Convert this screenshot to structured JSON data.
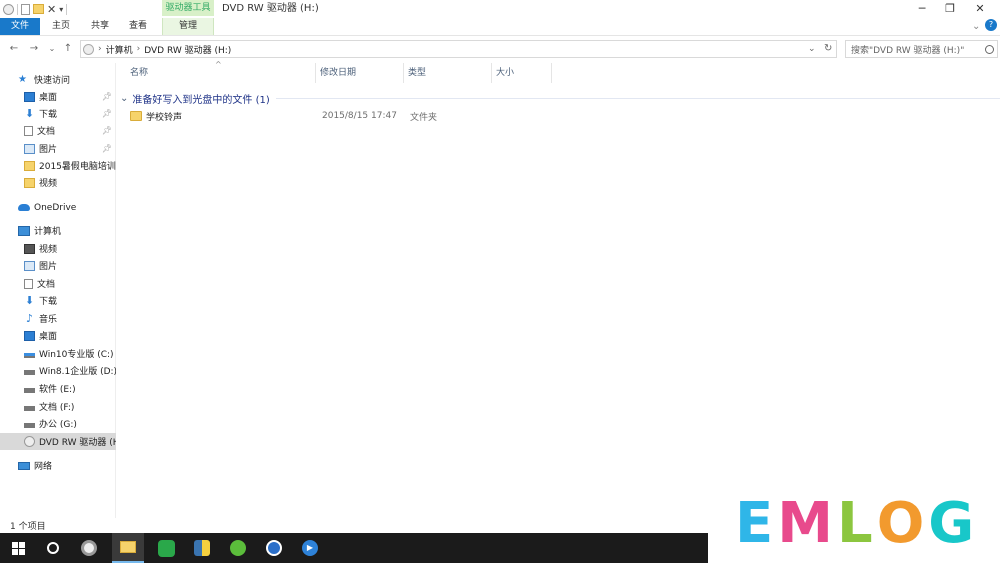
{
  "window": {
    "title": "DVD RW 驱动器 (H:)",
    "context_tab_header": "驱动器工具",
    "controls": {
      "minimize": "─",
      "restore": "❐",
      "close": "✕",
      "help": "?",
      "expand": "⌄"
    }
  },
  "ribbon": {
    "tabs": [
      "文件",
      "主页",
      "共享",
      "查看",
      "管理"
    ]
  },
  "address": {
    "back": "←",
    "forward": "→",
    "history": "⌄",
    "up": "↑",
    "crumbs": [
      "计算机",
      "DVD RW 驱动器 (H:)"
    ],
    "separator": "›",
    "dropdown": "⌄",
    "refresh": "↻"
  },
  "search": {
    "placeholder": "搜索\"DVD RW 驱动器 (H:)\"",
    "icon": "search-icon"
  },
  "nav": {
    "quick_access": "快速访问",
    "quick_items": [
      "桌面",
      "下载",
      "文档",
      "图片",
      "2015暑假电脑培训",
      "视频"
    ],
    "onedrive": "OneDrive",
    "computer": "计算机",
    "computer_items": [
      "视频",
      "图片",
      "文档",
      "下载",
      "音乐",
      "桌面",
      "Win10专业版 (C:)",
      "Win8.1企业版 (D:)",
      "软件 (E:)",
      "文档 (F:)",
      "办公 (G:)",
      "DVD RW 驱动器 (H:)"
    ],
    "network": "网络"
  },
  "columns": {
    "name": "名称",
    "modified": "修改日期",
    "type": "类型",
    "size": "大小",
    "sort_indicator": "^"
  },
  "group": {
    "title": "准备好写入到光盘中的文件 (1)",
    "chevron": "⌄"
  },
  "files": [
    {
      "name": "学校铃声",
      "modified": "2015/8/15 17:47",
      "type": "文件夹"
    }
  ],
  "status": {
    "count": "1 个项目"
  },
  "taskbar": {
    "items": [
      "start-icon",
      "cortana-icon",
      "fan-app-icon",
      "file-explorer-icon",
      "green-app-icon",
      "python-icon",
      "360-browser-icon",
      "sogou-icon",
      "media-player-icon"
    ]
  },
  "watermark": {
    "letters": [
      "E",
      "M",
      "L",
      "O",
      "G"
    ],
    "colors": [
      "#2fb6e8",
      "#e84a8c",
      "#8cc63f",
      "#f29a2e",
      "#18c7c9"
    ]
  }
}
